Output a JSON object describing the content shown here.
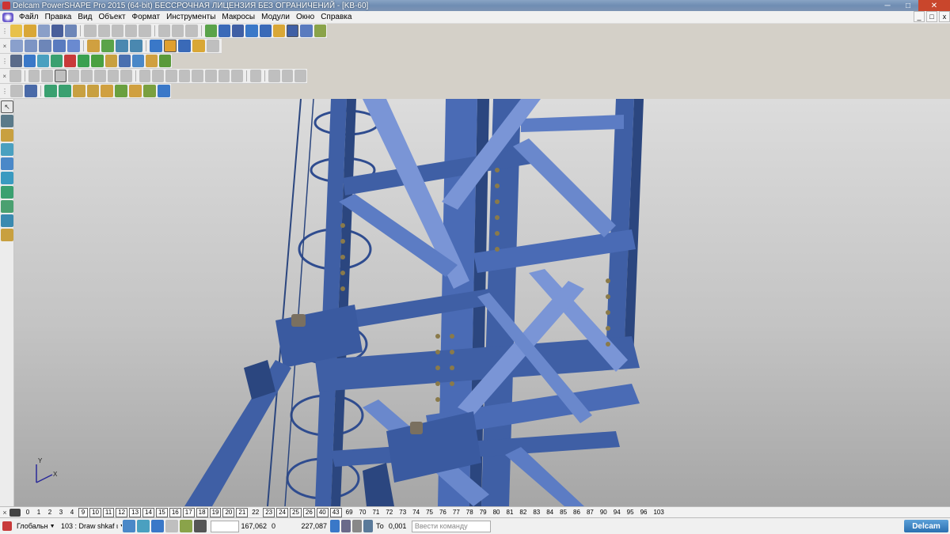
{
  "window": {
    "title": "Delcam PowerSHAPE Pro 2015 (64-bit) БЕССРОЧНАЯ ЛИЦЕНЗИЯ БЕЗ ОГРАНИЧЕНИЙ - [KB-60]",
    "minimize": "─",
    "maximize": "□",
    "close": "✕"
  },
  "menu": {
    "items": [
      "Файл",
      "Правка",
      "Вид",
      "Объект",
      "Формат",
      "Инструменты",
      "Макросы",
      "Модули",
      "Окно",
      "Справка"
    ],
    "doc_minimize": "_",
    "doc_restore": "□",
    "doc_close": "x"
  },
  "toolbar_close_glyph": "×",
  "levels": {
    "items": [
      {
        "label": "0",
        "on": false
      },
      {
        "label": "1",
        "on": false
      },
      {
        "label": "2",
        "on": false
      },
      {
        "label": "3",
        "on": false
      },
      {
        "label": "4",
        "on": false
      },
      {
        "label": "9",
        "on": true
      },
      {
        "label": "10",
        "on": true
      },
      {
        "label": "11",
        "on": true
      },
      {
        "label": "12",
        "on": true
      },
      {
        "label": "13",
        "on": true
      },
      {
        "label": "14",
        "on": true
      },
      {
        "label": "15",
        "on": true
      },
      {
        "label": "16",
        "on": true
      },
      {
        "label": "17",
        "on": true
      },
      {
        "label": "18",
        "on": true
      },
      {
        "label": "19",
        "on": true
      },
      {
        "label": "20",
        "on": true
      },
      {
        "label": "21",
        "on": true
      },
      {
        "label": "22",
        "on": false
      },
      {
        "label": "23",
        "on": true
      },
      {
        "label": "24",
        "on": true
      },
      {
        "label": "25",
        "on": true
      },
      {
        "label": "26",
        "on": true
      },
      {
        "label": "40",
        "on": true
      },
      {
        "label": "43",
        "on": true
      },
      {
        "label": "69",
        "on": false
      },
      {
        "label": "70",
        "on": false
      },
      {
        "label": "71",
        "on": false
      },
      {
        "label": "72",
        "on": false
      },
      {
        "label": "73",
        "on": false
      },
      {
        "label": "74",
        "on": false
      },
      {
        "label": "75",
        "on": false
      },
      {
        "label": "76",
        "on": false
      },
      {
        "label": "77",
        "on": false
      },
      {
        "label": "78",
        "on": false
      },
      {
        "label": "79",
        "on": false
      },
      {
        "label": "80",
        "on": false
      },
      {
        "label": "81",
        "on": false
      },
      {
        "label": "82",
        "on": false
      },
      {
        "label": "83",
        "on": false
      },
      {
        "label": "84",
        "on": false
      },
      {
        "label": "85",
        "on": false
      },
      {
        "label": "86",
        "on": false
      },
      {
        "label": "87",
        "on": false
      },
      {
        "label": "90",
        "on": false
      },
      {
        "label": "94",
        "on": false
      },
      {
        "label": "95",
        "on": false
      },
      {
        "label": "96",
        "on": false
      },
      {
        "label": "103",
        "on": false
      }
    ]
  },
  "status": {
    "workplane": "Глобальн",
    "level_select": "103 : Draw shkaf ι",
    "x": "167,062",
    "y": "0",
    "z": "227,087",
    "tolerance_label": "То",
    "tolerance": "0,001",
    "command_placeholder": "Ввести команду",
    "logo": "Delcam"
  },
  "axes": {
    "x": "X",
    "y": "Y"
  },
  "colors": {
    "steel": "#3f5fa5",
    "steel_light": "#7a95d6",
    "steel_dark": "#2b467f",
    "bolt": "#8a7a4a"
  }
}
